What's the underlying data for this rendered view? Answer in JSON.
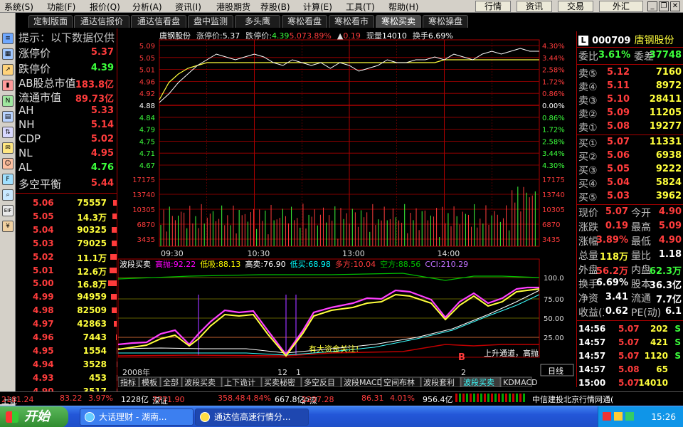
{
  "menu": [
    "系统(S)",
    "功能(F)",
    "报价(Q)",
    "分析(A)",
    "资讯(I)",
    "港股期货",
    "荐股(B)",
    "计算(E)",
    "工具(T)",
    "帮助(H)"
  ],
  "quick_buttons": [
    "行情",
    "资讯",
    "交易",
    "外汇"
  ],
  "toolbar_icons": [
    "list-icon",
    "grid-icon",
    "trend-chart-icon",
    "candle-chart-icon",
    "news-icon",
    "table-icon",
    "sort-icon",
    "mail-icon",
    "users-icon",
    "fund-icon",
    "search-icon",
    "eif-icon",
    "money-icon"
  ],
  "tabs": [
    "定制版面",
    "通达信报价",
    "通达信看盘",
    "盘中监测",
    "多头鹰",
    "寒松看盘",
    "寒松看市",
    "寒松买卖",
    "寒松操盘"
  ],
  "active_tab": "寒松买卖",
  "left_panel": {
    "hint": "提示：以下数据仅供",
    "items": [
      {
        "label": "涨停价",
        "value": "5.37"
      },
      {
        "label": "跌停价",
        "value": "4.39"
      },
      {
        "label": "AB股总市值",
        "value": "183.8亿"
      },
      {
        "label": "流通市值",
        "value": "89.73亿"
      },
      {
        "label": "AH",
        "value": "5.33"
      },
      {
        "label": "NH",
        "value": "5.14"
      },
      {
        "label": "CDP",
        "value": "5.02"
      },
      {
        "label": "NL",
        "value": "4.95"
      },
      {
        "label": "AL",
        "value": "4.76"
      },
      {
        "label": "多空平衡",
        "value": "5.44"
      }
    ],
    "price_volume": [
      [
        "5.06",
        "75557"
      ],
      [
        "5.05",
        "14.3万"
      ],
      [
        "5.04",
        "90325"
      ],
      [
        "5.03",
        "79025"
      ],
      [
        "5.02",
        "11.1万"
      ],
      [
        "5.01",
        "12.6万"
      ],
      [
        "5.00",
        "16.8万"
      ],
      [
        "4.99",
        "94959"
      ],
      [
        "4.98",
        "82509"
      ],
      [
        "4.97",
        "42863"
      ],
      [
        "4.96",
        "7443"
      ],
      [
        "4.95",
        "1554"
      ],
      [
        "4.94",
        "3528"
      ],
      [
        "4.93",
        "453"
      ],
      [
        "4.90",
        "3517"
      ]
    ]
  },
  "chart": {
    "stock_name": "唐钢股份",
    "header": [
      {
        "k": "涨停价:",
        "v": "5.37"
      },
      {
        "k": "跌停价:",
        "v": "4.39"
      },
      {
        "k": "",
        "v": "5.07"
      },
      {
        "k": "",
        "v": "3.89%"
      },
      {
        "k": "▲",
        "v": "0.19"
      },
      {
        "k": "现量",
        "v": "14010"
      },
      {
        "k": "换手",
        "v": "6.69%"
      }
    ],
    "price_ticks": [
      "5.09",
      "5.05",
      "5.01",
      "4.96",
      "4.92",
      "4.88",
      "4.84",
      "4.79",
      "4.75",
      "4.71",
      "4.67"
    ],
    "pct_ticks": [
      "4.30%",
      "3.44%",
      "2.58%",
      "1.72%",
      "0.86%",
      "0.00%",
      "0.86%",
      "1.72%",
      "2.58%",
      "3.44%",
      "4.30%"
    ],
    "vol_ticks": [
      "17175",
      "13740",
      "10305",
      "6870",
      "3435"
    ],
    "time_ticks": [
      "09:30",
      "10:30",
      "13:00",
      "14:00"
    ],
    "indicator": {
      "name": "波段买卖",
      "items": [
        {
          "k": "高抛:",
          "v": "92.22",
          "c": "#ff00ff"
        },
        {
          "k": "低吸:",
          "v": "88.13",
          "c": "#ffff00"
        },
        {
          "k": "高卖:",
          "v": "76.90",
          "c": "#ffffff"
        },
        {
          "k": "低买:",
          "v": "68.98",
          "c": "#00ffff"
        },
        {
          "k": "多方:",
          "v": "10.04",
          "c": "#ff3c3c"
        },
        {
          "k": "空方:",
          "v": "88.56",
          "c": "#00c000"
        },
        {
          "k": "CCI:",
          "v": "210.29",
          "c": "#c070ff"
        }
      ],
      "ticks": [
        "100.0",
        "75.00",
        "50.00",
        "25.00"
      ],
      "note1": "有大资金关注!",
      "note2": "上升通道，高抛",
      "mark": "B"
    },
    "date_year": "2008年",
    "date_mid": [
      "12",
      "1",
      "2"
    ],
    "bottom_tabs": [
      "指标",
      "模板",
      "全部",
      "波段买卖",
      "上下诡计",
      "买卖秘密",
      "多空反目",
      "波段MACD",
      "空间布林",
      "波段套利",
      "波段买卖",
      "KDMACD"
    ],
    "day_line": "日线",
    "intraday_price": [
      4.89,
      4.92,
      4.96,
      4.99,
      5.02,
      5.04,
      5.06,
      5.05,
      5.04,
      5.05,
      5.06,
      5.05,
      5.03,
      5.02,
      5.04,
      5.03,
      5.02,
      5.03,
      5.01,
      5.03,
      5.02,
      5.0,
      5.01,
      5.02,
      5.04,
      5.03,
      5.03,
      5.04,
      5.04,
      5.05,
      5.04,
      5.06,
      5.05,
      5.04,
      5.06,
      5.07,
      5.06,
      5.07,
      5.08,
      5.07,
      5.07
    ],
    "intraday_avg": [
      4.9,
      4.96,
      4.99,
      5.01,
      5.02,
      5.03,
      5.03,
      5.03,
      5.03,
      5.03,
      5.03,
      5.03,
      5.03,
      5.03,
      5.03,
      5.03,
      5.03,
      5.03,
      5.03,
      5.03,
      5.03,
      5.03,
      5.03,
      5.03,
      5.03,
      5.03,
      5.03,
      5.03,
      5.03,
      5.03,
      5.04,
      5.04,
      5.04,
      5.04,
      5.04,
      5.04,
      5.04,
      5.04,
      5.04,
      5.04,
      5.04
    ]
  },
  "right_panel": {
    "code": "000709",
    "name": "唐钢股份",
    "weibi": {
      "k": "委比",
      "v": "3.61%"
    },
    "weicha": {
      "k": "委差",
      "v": "37748"
    },
    "sells": [
      [
        "卖⑤",
        "5.12",
        "7160"
      ],
      [
        "卖④",
        "5.11",
        "8972"
      ],
      [
        "卖③",
        "5.10",
        "28411"
      ],
      [
        "卖②",
        "5.09",
        "11205"
      ],
      [
        "卖①",
        "5.08",
        "19277"
      ]
    ],
    "buys": [
      [
        "买①",
        "5.07",
        "11331"
      ],
      [
        "买②",
        "5.06",
        "6938"
      ],
      [
        "买③",
        "5.05",
        "9222"
      ],
      [
        "买④",
        "5.04",
        "5824"
      ],
      [
        "买⑤",
        "5.03",
        "3962"
      ]
    ],
    "stats": [
      [
        "现价",
        "5.07",
        "今开",
        "4.90"
      ],
      [
        "涨跌",
        "0.19",
        "最高",
        "5.09"
      ],
      [
        "涨幅",
        "3.89%",
        "最低",
        "4.90"
      ],
      [
        "总量",
        "118万",
        "量比",
        "1.18"
      ],
      [
        "外盘",
        "56.2万",
        "内盘",
        "62.3万"
      ],
      [
        "换手",
        "6.69%",
        "股本",
        "36.3亿"
      ],
      [
        "净资",
        "3.41",
        "流通",
        "7.7亿"
      ],
      [
        "收益(三)",
        "0.62",
        "PE(动)",
        "6.1"
      ]
    ],
    "trades": [
      [
        "14:56",
        "5.07",
        "202",
        "S"
      ],
      [
        "14:57",
        "5.07",
        "421",
        "S"
      ],
      [
        "14:57",
        "5.07",
        "1120",
        "S"
      ],
      [
        "14:57",
        "5.08",
        "65",
        ""
      ],
      [
        "15:00",
        "5.07",
        "14010",
        ""
      ]
    ]
  },
  "status": [
    {
      "k": "上证",
      "v": "2181.24",
      "c": "83.22",
      "p": "3.97%",
      "a": "1228亿"
    },
    {
      "k": "深证",
      "v": "7771.90",
      "c": "358.48",
      "p": "4.84%",
      "a": "667.8亿"
    },
    {
      "k": "沪深",
      "v": "2237.28",
      "c": "86.31",
      "p": "4.01%",
      "a": "956.4亿"
    }
  ],
  "status_right": "中信建投北京行情网通(",
  "taskbar": {
    "start": "开始",
    "tasks": [
      "大话理财 - 湖南...",
      "通达信高速行情分..."
    ],
    "clock": "15:26"
  }
}
